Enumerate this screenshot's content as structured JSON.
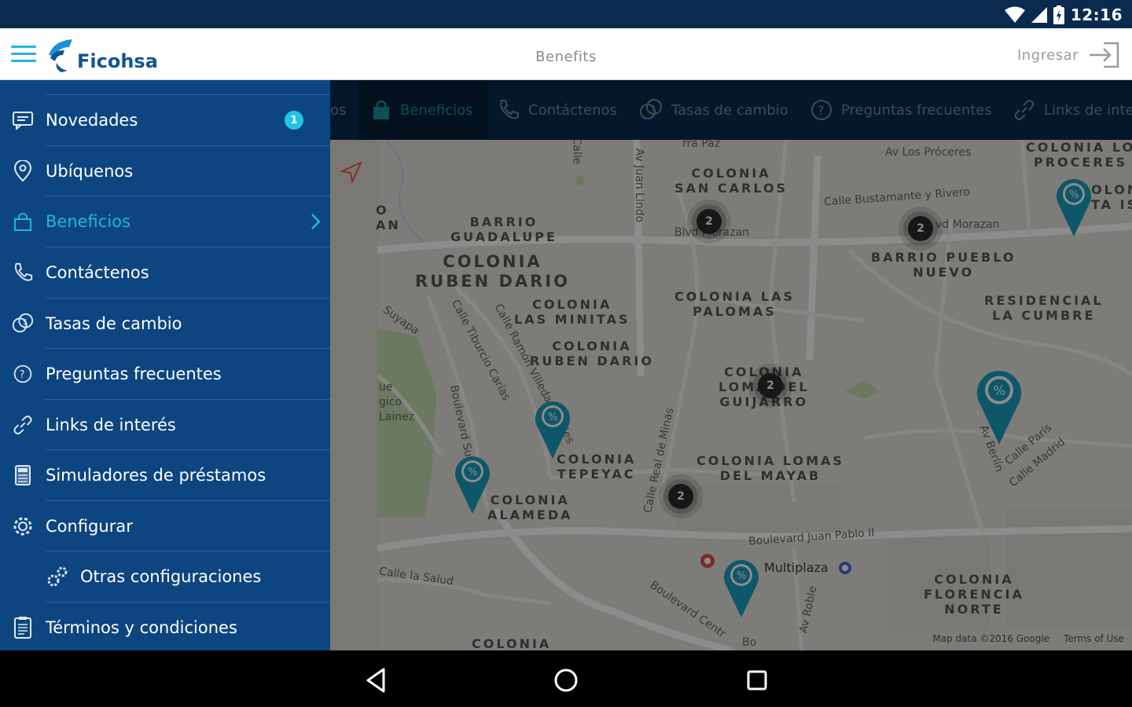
{
  "status_bar": {
    "time": "12:16",
    "icons": [
      "wifi-icon",
      "signal-icon",
      "battery-icon"
    ]
  },
  "app_bar": {
    "logo_text": "Ficohsa",
    "title": "Benefits",
    "login_label": "Ingresar"
  },
  "tabs": [
    {
      "label": "os",
      "icon": "none"
    },
    {
      "label": "Beneficios",
      "icon": "bag-icon",
      "active": true
    },
    {
      "label": "Contáctenos",
      "icon": "phone-icon"
    },
    {
      "label": "Tasas de cambio",
      "icon": "exchange-icon"
    },
    {
      "label": "Preguntas frecuentes",
      "icon": "question-icon"
    },
    {
      "label": "Links de inter",
      "icon": "link-icon"
    }
  ],
  "drawer": {
    "items": [
      {
        "label": "Novedades",
        "icon": "message-icon",
        "badge": "1"
      },
      {
        "label": "Ubíquenos",
        "icon": "location-icon"
      },
      {
        "label": "Beneficios",
        "icon": "bag-icon",
        "active": true
      },
      {
        "label": "Contáctenos",
        "icon": "phone-icon"
      },
      {
        "label": "Tasas de cambio",
        "icon": "exchange-icon"
      },
      {
        "label": "Preguntas frecuentes",
        "icon": "question-icon"
      },
      {
        "label": "Links de interés",
        "icon": "link-icon"
      },
      {
        "label": "Simuladores de préstamos",
        "icon": "calculator-icon"
      },
      {
        "label": "Configurar",
        "icon": "gear-icon"
      },
      {
        "label": "Otras configuraciones",
        "icon": "gears-icon",
        "sub": true
      },
      {
        "label": "Términos y condiciones",
        "icon": "document-icon"
      }
    ]
  },
  "map": {
    "neighborhoods": [
      "COLONIA\nSAN CARLOS",
      "BARRIO\nGUADALUPE",
      "COLONIA\nRUBEN DARIO",
      "COLONIA\nLAS MINITAS",
      "COLONIA\nRUBEN DARIO",
      "COLONIA LAS\nPALOMAS",
      "BARRIO PUEBLO\nNUEVO",
      "RESIDENCIAL\nLA CUMBRE",
      "COLONIA LO\nPROCERES",
      "COLONIA\nLOMA DEL\nGUIJARRO",
      "COLONIA\nTEPEYAC",
      "COLONIA\nALAMEDA",
      "COLONIA LOMAS\nDEL MAYAB",
      "COLONIA\nFLORENCIA\nNORTE",
      "COLONIA",
      "O\nAN",
      "OLON\nTA IS"
    ],
    "streets": [
      "Av Los Próceres",
      "Calle Bustamante y Rivero",
      "Blvd Morazan",
      "vd Morazan",
      "Boulevard Juan Pablo II",
      "Multiplaza",
      "Boulevard Centr",
      "Bo",
      "Av Juan Lindo",
      "Calle Real de Minas",
      "Av Berlín",
      "Calle París",
      "Calle Madrid",
      "Calle Tiburcio Carías",
      "Calle Ramón Villeda Morales",
      "Boulevard Su",
      "Suyapa",
      "Calle la Salud",
      "Av Roble",
      "ue\ngico\nLainez",
      "Calle",
      "rra Paz"
    ],
    "clusters": [
      "2",
      "2",
      "2",
      "2"
    ],
    "footer_data": "Map data ©2016 Google",
    "footer_terms": "Terms of Use"
  },
  "colors": {
    "drawer_bg": "#0d4580",
    "accent": "#21b6dc",
    "tabs_bg": "#0a2a4d",
    "pin": "#1a9fc0"
  }
}
